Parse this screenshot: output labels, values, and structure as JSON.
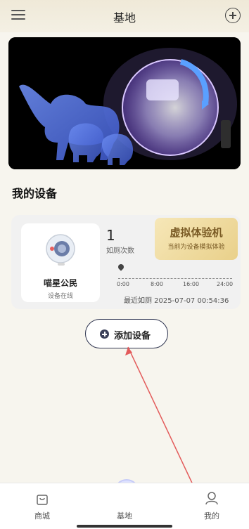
{
  "header": {
    "title": "基地"
  },
  "section": {
    "title": "我的设备"
  },
  "device": {
    "name": "喵星公民",
    "status": "设备在线",
    "count": "1",
    "count_label": "如厕次数",
    "virtual_title": "虚拟体验机",
    "virtual_sub": "当前为设备模拟体验",
    "ticks": [
      "0:00",
      "8:00",
      "16:00",
      "24:00"
    ],
    "last_time": "最近如厕 2025-07-07 00:54:36"
  },
  "add_button": {
    "label": "添加设备"
  },
  "tabbar": {
    "items": [
      {
        "label": "商城"
      },
      {
        "label": "基地"
      },
      {
        "label": "我的"
      }
    ]
  }
}
